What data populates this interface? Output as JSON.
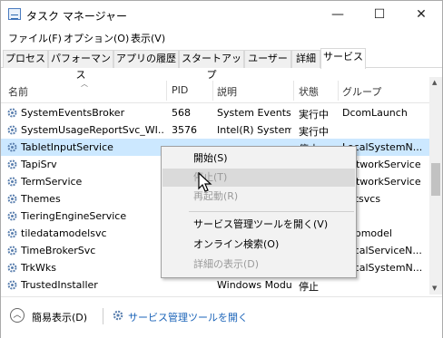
{
  "window": {
    "title": "タスク マネージャー",
    "minimize": "—",
    "maximize": "☐",
    "close": "✕"
  },
  "menu": [
    "ファイル(F)",
    "オプション(O)",
    "表示(V)"
  ],
  "tabs": [
    "プロセス",
    "パフォーマンス",
    "アプリの履歴",
    "スタートアップ",
    "ユーザー",
    "詳細",
    "サービス"
  ],
  "active_tab": "サービス",
  "table": {
    "headers": [
      "名前",
      "PID",
      "説明",
      "状態",
      "グループ"
    ],
    "rows": [
      {
        "name": "SystemEventsBroker",
        "pid": "568",
        "desc": "System Events B",
        "status": "実行中",
        "group": "DcomLaunch"
      },
      {
        "name": "SystemUsageReportSvc_WI...",
        "pid": "3576",
        "desc": "Intel(R) System",
        "status": "実行中",
        "group": ""
      },
      {
        "name": "TabletInputService",
        "pid": "",
        "desc": "",
        "status": "停止",
        "group": "LocalSystemN..."
      },
      {
        "name": "TapiSrv",
        "pid": "",
        "desc": "",
        "status": "",
        "group": "NetworkService"
      },
      {
        "name": "TermService",
        "pid": "",
        "desc": "",
        "status": "",
        "group": "NetworkService"
      },
      {
        "name": "Themes",
        "pid": "",
        "desc": "",
        "status": "",
        "group": "netsvcs"
      },
      {
        "name": "TieringEngineService",
        "pid": "",
        "desc": "",
        "status": "",
        "group": ""
      },
      {
        "name": "tiledatamodelsvc",
        "pid": "",
        "desc": "",
        "status": "",
        "group": "appmodel"
      },
      {
        "name": "TimeBrokerSvc",
        "pid": "",
        "desc": "",
        "status": "",
        "group": "LocalServiceN..."
      },
      {
        "name": "TrkWks",
        "pid": "",
        "desc": "",
        "status": "",
        "group": "LocalSystemN..."
      },
      {
        "name": "TrustedInstaller",
        "pid": "",
        "desc": "Windows Modu",
        "status": "停止",
        "group": ""
      }
    ]
  },
  "context_menu": {
    "start": "開始(S)",
    "stop": "停止(T)",
    "restart": "再起動(R)",
    "open_services": "サービス管理ツールを開く(V)",
    "search_online": "オンライン検索(O)",
    "go_to_details": "詳細の表示(D)"
  },
  "bottom": {
    "fewer_details": "簡易表示(D)",
    "open_services_link": "サービス管理ツールを開く"
  },
  "colors": {
    "selection": "#cce8ff",
    "link": "#1a63b8",
    "icon_gear": "#5a7fae"
  }
}
